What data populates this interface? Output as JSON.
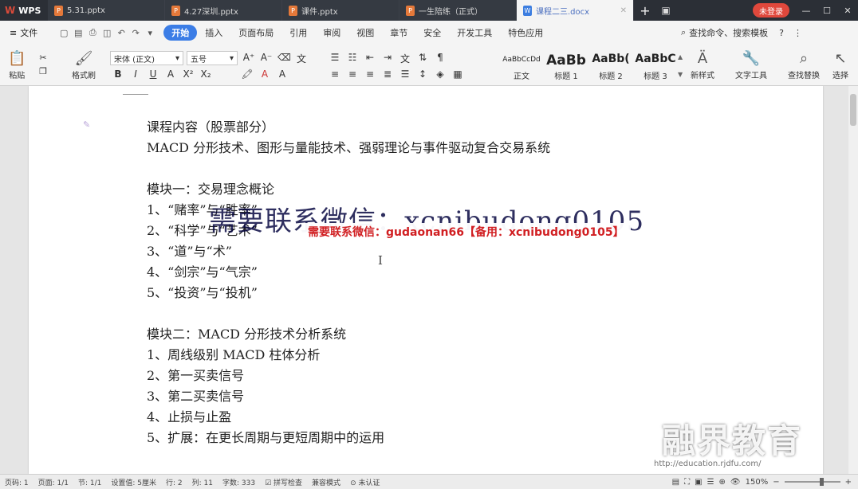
{
  "titlebar": {
    "app_name": "WPS",
    "tabs": [
      {
        "label": "5.31.pptx",
        "type": "ppt",
        "active": false
      },
      {
        "label": "4.27深圳.pptx",
        "type": "ppt",
        "active": false
      },
      {
        "label": "课件.pptx",
        "type": "ppt",
        "active": false
      },
      {
        "label": "一生陪练（正式）",
        "type": "ppt",
        "active": false
      },
      {
        "label": "课程二三.docx",
        "type": "doc",
        "active": true
      }
    ],
    "login_label": "未登录"
  },
  "menubar": {
    "file_label": "文件",
    "items": [
      "开始",
      "插入",
      "页面布局",
      "引用",
      "审阅",
      "视图",
      "章节",
      "安全",
      "开发工具",
      "特色应用"
    ],
    "active_item": "开始",
    "search_label": "查找命令、搜索模板"
  },
  "ribbon": {
    "paste_label": "粘贴",
    "format_painter_label": "格式刷",
    "font_name": "宋体 (正文)",
    "font_size": "五号",
    "styles": [
      {
        "sample": "AaBbCcDd",
        "name": "正文"
      },
      {
        "sample": "AaBb",
        "name": "标题 1"
      },
      {
        "sample": "AaBb(",
        "name": "标题 2"
      },
      {
        "sample": "AaBbC",
        "name": "标题 3"
      }
    ],
    "new_style_label": "新样式",
    "text_tools_label": "文字工具",
    "find_replace_label": "查找替换",
    "select_label": "选择"
  },
  "document": {
    "lines": [
      "课程内容（股票部分）",
      "MACD 分形技术、图形与量能技术、强弱理论与事件驱动复合交易系统",
      "",
      "模块一：交易理念概论",
      "1、“赌率”与“胜率”",
      "2、“科学”与“艺术”",
      "3、“道”与“术”",
      "4、“剑宗”与“气宗”",
      "5、“投资”与“投机”",
      "",
      "模块二：MACD 分形技术分析系统",
      "1、周线级别 MACD 柱体分析",
      "2、第一买卖信号",
      "3、第二买卖信号",
      "4、止损与止盈",
      "5、扩展：在更长周期与更短周期中的运用"
    ]
  },
  "overlays": {
    "watermark_large": "需要联系微信：xcnibudong0105",
    "watermark_banner": "需要联系微信：gudaonan66【备用：xcnibudong0105】",
    "brand": "融界教育",
    "brand_url": "http://education.rjdfu.com/"
  },
  "statusbar": {
    "page_num": "页码: 1",
    "page_of": "页面: 1/1",
    "section": "节: 1/1",
    "position": "设置值: 5厘米",
    "row": "行: 2",
    "col": "列: 11",
    "word_count": "字数: 333",
    "spell_check": "拼写检查",
    "compat_mode": "兼容模式",
    "auth": "未认证",
    "zoom": "150%"
  }
}
